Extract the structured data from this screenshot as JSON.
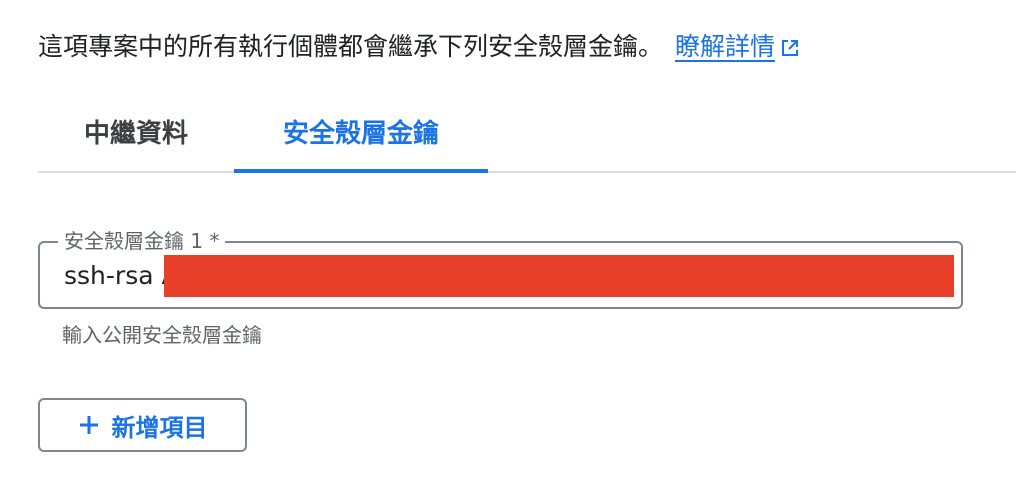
{
  "intro": {
    "text": "這項專案中的所有執行個體都會繼承下列安全殼層金鑰。",
    "learn_more": "瞭解詳情"
  },
  "tabs": [
    {
      "label": "中繼資料",
      "selected": false
    },
    {
      "label": "安全殼層金鑰",
      "selected": true
    }
  ],
  "ssh_key_field": {
    "label": "安全殼層金鑰 1 *",
    "value": "ssh-rsa A",
    "hint": "輸入公開安全殼層金鑰"
  },
  "add_button": {
    "label": "新增項目",
    "icon": "plus-icon"
  },
  "colors": {
    "accent": "#1a73e8",
    "redaction": "#e8402a"
  }
}
